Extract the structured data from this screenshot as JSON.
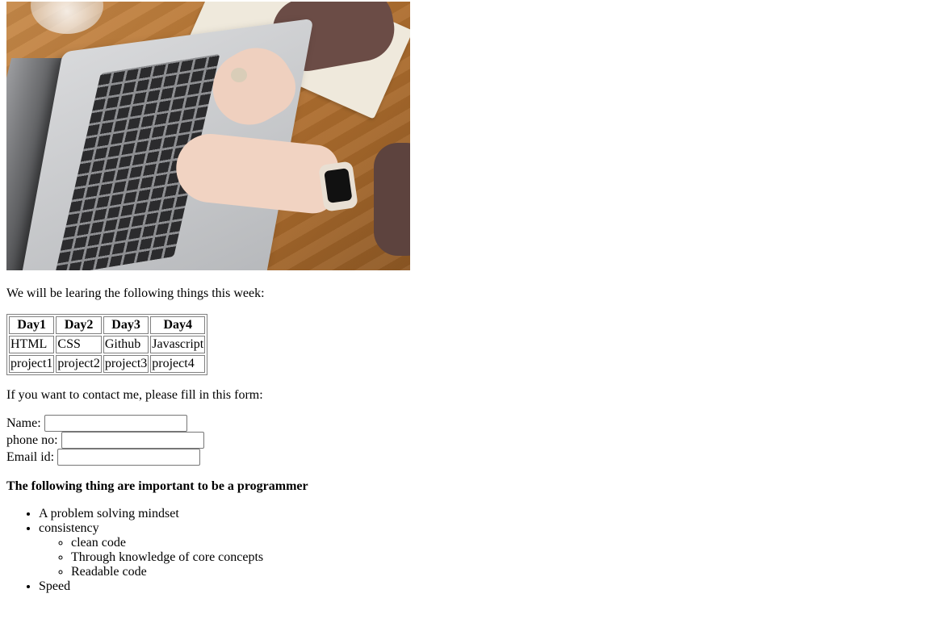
{
  "hero_image": {
    "description_icon": "laptop-typing-photo"
  },
  "intro_text": "We will be learing the following things this week:",
  "schedule": {
    "headers": [
      "Day1",
      "Day2",
      "Day3",
      "Day4"
    ],
    "rows": [
      [
        "HTML",
        "CSS",
        "Github",
        "Javascript"
      ],
      [
        "project1",
        "project2",
        "project3",
        "project4"
      ]
    ]
  },
  "contact_intro": "If you want to contact me, please fill in this form:",
  "form": {
    "name_label": "Name:",
    "name_value": "",
    "phone_label": "phone no:",
    "phone_value": "",
    "email_label": "Email id:",
    "email_value": ""
  },
  "important_heading": "The following thing are important to be a programmer",
  "skills": {
    "items": [
      "A problem solving mindset",
      "consistency",
      "Speed"
    ],
    "consistency_sub": [
      "clean code",
      "Through knowledge of core concepts",
      "Readable code"
    ]
  }
}
